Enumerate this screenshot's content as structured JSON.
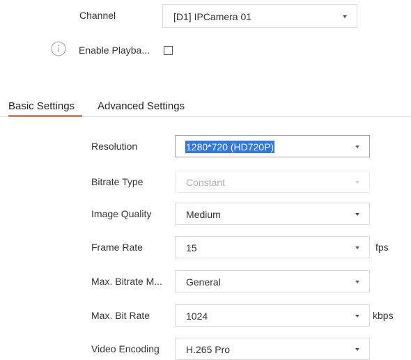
{
  "channel": {
    "label": "Channel",
    "value": "[D1] IPCamera 01"
  },
  "playback": {
    "label": "Enable Playba...",
    "checked": false,
    "info_icon": "info-icon"
  },
  "tabs": [
    {
      "label": "Basic Settings",
      "active": true
    },
    {
      "label": "Advanced Settings",
      "active": false
    }
  ],
  "accent_color": "#f07b3a",
  "settings": {
    "resolution": {
      "label": "Resolution",
      "value": "1280*720 (HD720P)"
    },
    "bitrate_type": {
      "label": "Bitrate Type",
      "value": "Constant",
      "disabled": true
    },
    "image_quality": {
      "label": "Image Quality",
      "value": "Medium"
    },
    "frame_rate": {
      "label": "Frame Rate",
      "value": "15",
      "unit": "fps"
    },
    "max_bitrate_mode": {
      "label": "Max. Bitrate M...",
      "value": "General"
    },
    "max_bit_rate": {
      "label": "Max. Bit Rate",
      "value": "1024",
      "unit": "kbps"
    },
    "video_encoding": {
      "label": "Video Encoding",
      "value": "H.265 Pro"
    }
  }
}
